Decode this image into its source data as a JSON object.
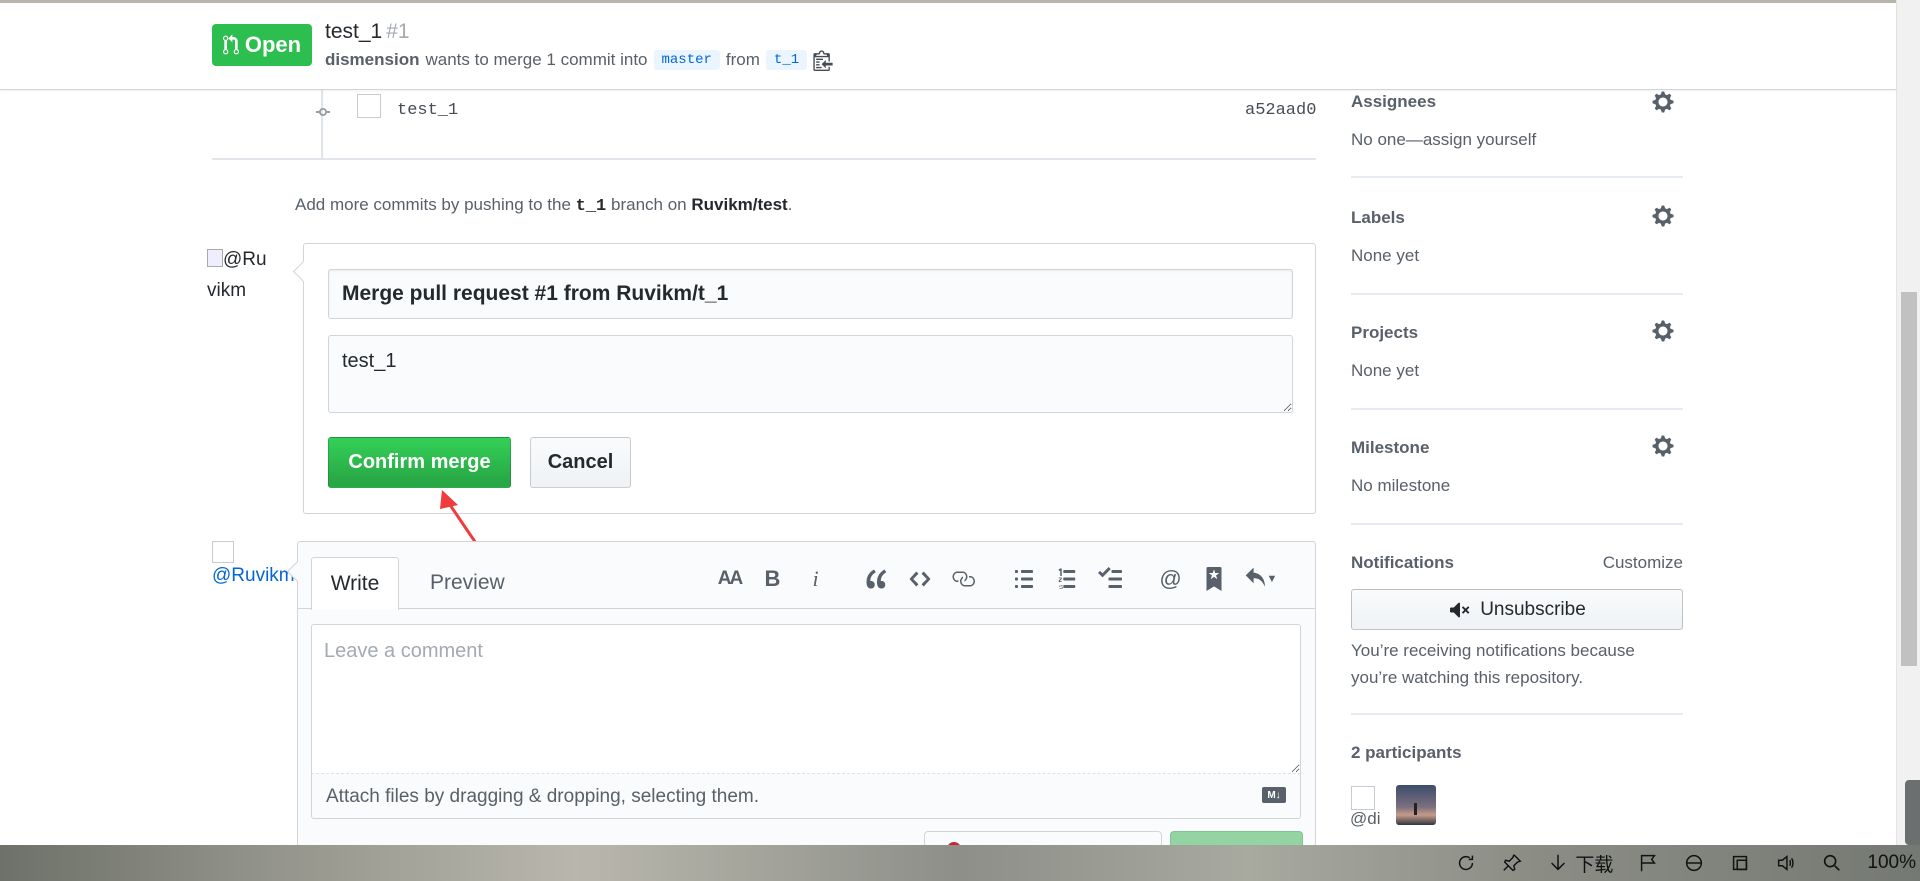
{
  "header": {
    "state_label": "Open",
    "title": "test_1",
    "number": "#1",
    "author": "dismension",
    "meta_text": "wants to merge 1 commit into",
    "base_branch": "master",
    "from_text": "from",
    "head_branch": "t_1"
  },
  "commit": {
    "message": "test_1",
    "sha": "a52aad0"
  },
  "add_commits": {
    "prefix": "Add more commits by pushing to the",
    "branch": "t_1",
    "middle": "branch on",
    "repo": "Ruvikm/test",
    "suffix": "."
  },
  "merge_form": {
    "avatar_alt": "@Ruvikm",
    "title_value": "Merge pull request #1 from Ruvikm/t_1",
    "body_value": "test_1",
    "confirm_label": "Confirm merge",
    "cancel_label": "Cancel"
  },
  "comment_form": {
    "avatar_alt": "@Ruvikm",
    "tab_write": "Write",
    "tab_preview": "Preview",
    "placeholder": "Leave a comment",
    "attach_text": "Attach files by dragging & dropping, selecting them.",
    "markdown_badge": "M↓",
    "toolbar_heading": "AA",
    "toolbar_bold": "B",
    "toolbar_italic": "i",
    "toolbar_mention": "@"
  },
  "sidebar": {
    "assignees": {
      "heading": "Assignees",
      "value": "No one—assign yourself"
    },
    "labels": {
      "heading": "Labels",
      "value": "None yet"
    },
    "projects": {
      "heading": "Projects",
      "value": "None yet"
    },
    "milestone": {
      "heading": "Milestone",
      "value": "No milestone"
    },
    "notifications": {
      "heading": "Notifications",
      "customize": "Customize",
      "unsubscribe": "Unsubscribe",
      "reason": "You’re receiving notifications because you’re watching this repository."
    },
    "participants": {
      "heading": "2 participants",
      "first_label": "@di"
    }
  },
  "taskbar": {
    "download_label": "下载",
    "zoom": "100%"
  },
  "colors": {
    "open_green": "#2cbe4e",
    "merge_green": "#28a745",
    "link_blue": "#0366d6",
    "arrow_red": "#f03c3c"
  }
}
